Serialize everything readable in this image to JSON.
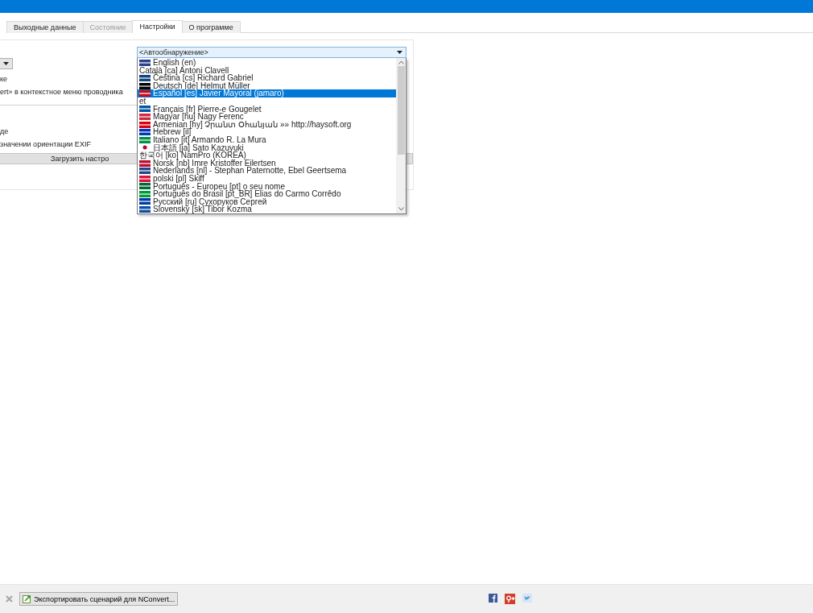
{
  "tabs": [
    {
      "label": "Выходные данные",
      "selected": false,
      "disabled": false
    },
    {
      "label": "Состояние",
      "selected": false,
      "disabled": true
    },
    {
      "label": "Настройки",
      "selected": true,
      "disabled": false
    },
    {
      "label": "О программе",
      "selected": false,
      "disabled": false
    }
  ],
  "settings": [
    {
      "kind": "dropdown"
    },
    {
      "kind": "text",
      "text": "ке"
    },
    {
      "kind": "text",
      "text": "ert» в контекстное меню проводника"
    },
    {
      "kind": "divider"
    },
    {
      "kind": "text",
      "text": "де"
    },
    {
      "kind": "text",
      "text": "значении ориентации EXIF"
    },
    {
      "kind": "button",
      "text": "Загрузить настро"
    }
  ],
  "language_combo": {
    "value": "<Автообнаружение>",
    "expanded": true,
    "options": [
      {
        "label": "English (en)",
        "selected": false,
        "kind": "flag",
        "color": "#2b3f8f"
      },
      {
        "label": "Català [ca] Antoni Clavell",
        "selected": false,
        "kind": "plain"
      },
      {
        "label": "Čeština [cs] Richard Gabriel",
        "selected": false,
        "kind": "flag",
        "color": "#11457e"
      },
      {
        "label": "Deutsch [de] Helmut Müller",
        "selected": false,
        "kind": "flag",
        "color": "#000000"
      },
      {
        "label": "Español [es] Javier Mayoral (jamaro)",
        "selected": true,
        "kind": "flag",
        "color": "#c60b1e"
      },
      {
        "label": "et",
        "selected": false,
        "kind": "plain"
      },
      {
        "label": "Français [fr] Pierre-e Gougelet",
        "selected": false,
        "kind": "flag",
        "color": "#0055a4"
      },
      {
        "label": "Magyar [hu] Nagy Ferenc",
        "selected": false,
        "kind": "flag",
        "color": "#cd2a3e"
      },
      {
        "label": "Armenian [hy] Չրանտ Օհանյան »» http://haysoft.org",
        "selected": false,
        "kind": "flag",
        "color": "#d90012"
      },
      {
        "label": "Hebrew [il]",
        "selected": false,
        "kind": "flag",
        "color": "#0038b8"
      },
      {
        "label": "Italiano [it] Armando R. La Mura",
        "selected": false,
        "kind": "flag",
        "color": "#009246"
      },
      {
        "label": "日本語 [ja] Sato Kazuyuki",
        "selected": false,
        "kind": "dot",
        "color": "#bc002d"
      },
      {
        "label": "한국어 [ko] NamPro (KOREA)",
        "selected": false,
        "kind": "plain"
      },
      {
        "label": "Norsk [nb] Imre Kristoffer Eilertsen",
        "selected": false,
        "kind": "flag",
        "color": "#ba0c2f"
      },
      {
        "label": "Nederlands [nl]  - Stephan Paternotte, Ebel Geertsema",
        "selected": false,
        "kind": "flag",
        "color": "#21468b"
      },
      {
        "label": "polski [pl] Skiff",
        "selected": false,
        "kind": "flag",
        "color": "#dc143c"
      },
      {
        "label": "Português - Europeu [pt] o seu nome",
        "selected": false,
        "kind": "flag",
        "color": "#046a38"
      },
      {
        "label": "Português do Brasil [pt_BR] Elias do Carmo Corrêdo",
        "selected": false,
        "kind": "flag",
        "color": "#009c3b"
      },
      {
        "label": "Русский [ru] Сухоруков Сергей",
        "selected": false,
        "kind": "flag",
        "color": "#0039a6"
      },
      {
        "label": "Slovenský [sk] Tibor Kozma",
        "selected": false,
        "kind": "flag",
        "color": "#0b4ea2"
      }
    ]
  },
  "status_bar": {
    "export_button": "Экспортировать сценарий для NConvert..."
  }
}
